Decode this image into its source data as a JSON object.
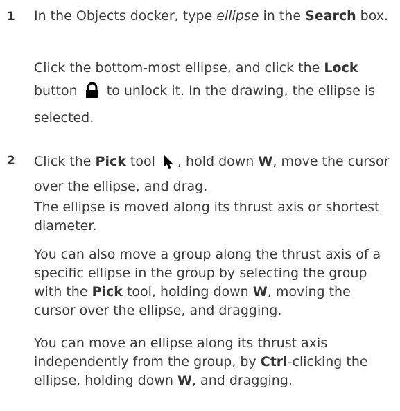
{
  "steps": [
    {
      "number": "1",
      "paragraphs": [
        {
          "parts": [
            {
              "t": "In the Objects docker, type "
            },
            {
              "t": "ellipse",
              "s": "i"
            },
            {
              "t": " in the "
            },
            {
              "t": "Search",
              "s": "b"
            },
            {
              "t": " box."
            }
          ]
        },
        {
          "parts": [
            {
              "t": "Click the bottom-most ellipse, and click the "
            },
            {
              "t": "Lock",
              "s": "b"
            },
            {
              "t": " button "
            },
            {
              "icon": "lock-icon"
            },
            {
              "t": " to unlock it. In the drawing, the ellipse is selected."
            }
          ]
        }
      ]
    },
    {
      "number": "2",
      "paragraphs": [
        {
          "parts": [
            {
              "t": "Click the "
            },
            {
              "t": "Pick",
              "s": "b"
            },
            {
              "t": " tool "
            },
            {
              "icon": "pick-tool-icon"
            },
            {
              "t": ", hold down "
            },
            {
              "t": "W",
              "s": "b"
            },
            {
              "t": ", move the cursor over the ellipse, and drag."
            }
          ]
        },
        {
          "parts": [
            {
              "t": "The ellipse is moved along its thrust axis or shortest diameter."
            }
          ]
        },
        {
          "parts": [
            {
              "t": "You can also move a group along the thrust axis of a specific ellipse in the group by selecting the group with the "
            },
            {
              "t": "Pick",
              "s": "b"
            },
            {
              "t": " tool, holding down "
            },
            {
              "t": "W",
              "s": "b"
            },
            {
              "t": ", moving the cursor over the ellipse, and dragging."
            }
          ]
        },
        {
          "parts": [
            {
              "t": "You can move an ellipse along its thrust axis independently from the group, by "
            },
            {
              "t": "Ctrl",
              "s": "b"
            },
            {
              "t": "-clicking the ellipse, holding down "
            },
            {
              "t": "W",
              "s": "b"
            },
            {
              "t": ", and dragging."
            }
          ]
        }
      ]
    }
  ]
}
